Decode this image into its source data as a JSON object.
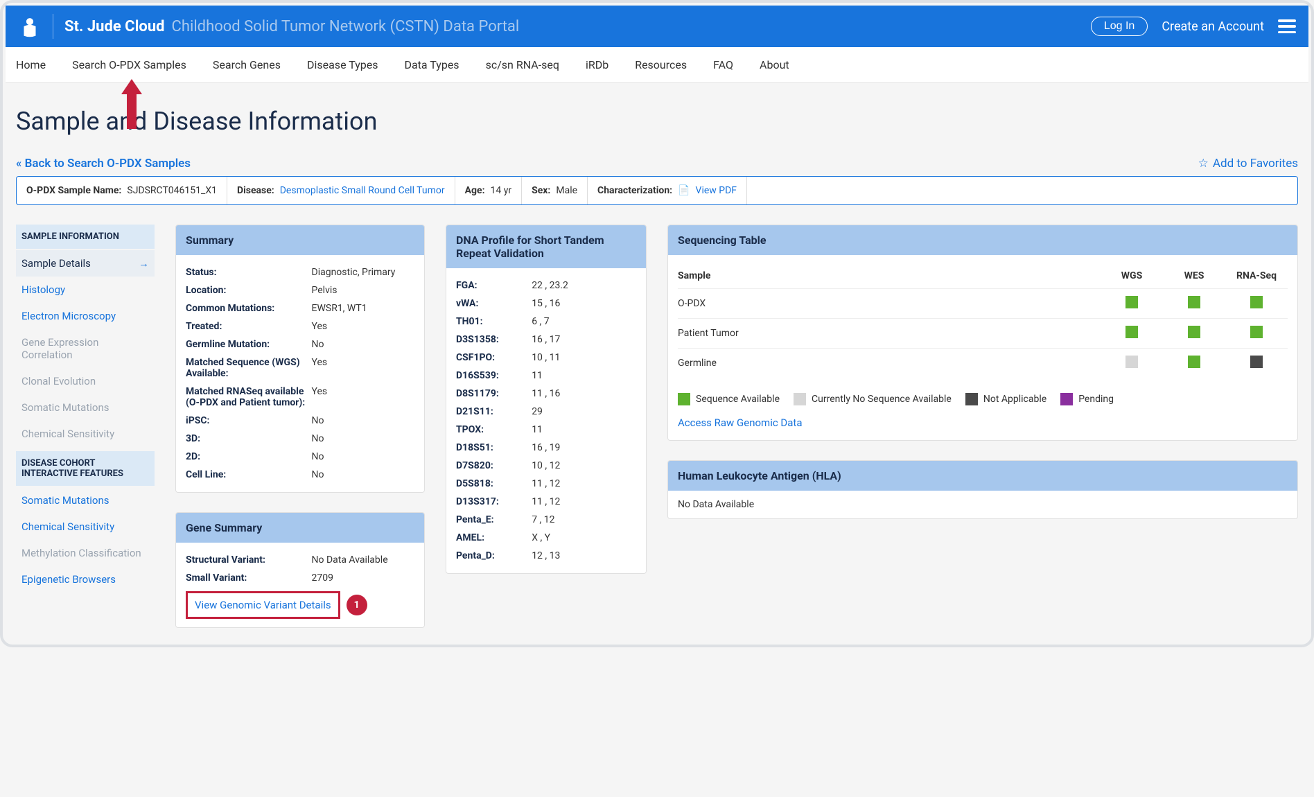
{
  "header": {
    "brand": "St. Jude Cloud",
    "subtitle": "Childhood Solid Tumor Network (CSTN) Data Portal",
    "login": "Log In",
    "create": "Create an Account"
  },
  "nav": {
    "items": [
      "Home",
      "Search O-PDX Samples",
      "Search Genes",
      "Disease Types",
      "Data Types",
      "sc/sn RNA-seq",
      "iRDb",
      "Resources",
      "FAQ",
      "About"
    ]
  },
  "page": {
    "title": "Sample and Disease Information",
    "back": "« Back to Search O-PDX Samples",
    "favorite": "Add to Favorites"
  },
  "info": {
    "sample_name_label": "O-PDX Sample Name:",
    "sample_name_value": "SJDSRCT046151_X1",
    "disease_label": "Disease:",
    "disease_value": "Desmoplastic Small Round Cell Tumor",
    "age_label": "Age:",
    "age_value": "14 yr",
    "sex_label": "Sex:",
    "sex_value": "Male",
    "char_label": "Characterization:",
    "char_value": "View PDF"
  },
  "sidebar": {
    "section1": "SAMPLE INFORMATION",
    "items1": [
      {
        "label": "Sample Details",
        "state": "active"
      },
      {
        "label": "Histology",
        "state": "link"
      },
      {
        "label": "Electron Microscopy",
        "state": "link"
      },
      {
        "label": "Gene Expression Correlation",
        "state": "muted"
      },
      {
        "label": "Clonal Evolution",
        "state": "muted"
      },
      {
        "label": "Somatic Mutations",
        "state": "muted"
      },
      {
        "label": "Chemical Sensitivity",
        "state": "muted"
      }
    ],
    "section2": "DISEASE COHORT INTERACTIVE FEATURES",
    "items2": [
      {
        "label": "Somatic Mutations",
        "state": "link"
      },
      {
        "label": "Chemical Sensitivity",
        "state": "link"
      },
      {
        "label": "Methylation Classification",
        "state": "muted"
      },
      {
        "label": "Epigenetic Browsers",
        "state": "link"
      }
    ]
  },
  "summary": {
    "title": "Summary",
    "rows": [
      {
        "k": "Status:",
        "v": "Diagnostic, Primary"
      },
      {
        "k": "Location:",
        "v": "Pelvis"
      },
      {
        "k": "Common Mutations:",
        "v": "EWSR1, WT1"
      },
      {
        "k": "Treated:",
        "v": "Yes"
      },
      {
        "k": "Germline Mutation:",
        "v": "No"
      },
      {
        "k": "Matched Sequence (WGS) Available:",
        "v": "Yes"
      },
      {
        "k": "Matched RNASeq available (O-PDX and Patient tumor):",
        "v": "Yes"
      },
      {
        "k": "iPSC:",
        "v": "No"
      },
      {
        "k": "3D:",
        "v": "No"
      },
      {
        "k": "2D:",
        "v": "No"
      },
      {
        "k": "Cell Line:",
        "v": "No"
      }
    ]
  },
  "gene_summary": {
    "title": "Gene Summary",
    "rows": [
      {
        "k": "Structural Variant:",
        "v": "No Data Available"
      },
      {
        "k": "Small Variant:",
        "v": "2709"
      }
    ],
    "view_link": "View Genomic Variant Details",
    "step": "1"
  },
  "dna": {
    "title": "DNA Profile for Short Tandem Repeat Validation",
    "rows": [
      {
        "k": "FGA:",
        "v": "22 , 23.2"
      },
      {
        "k": "vWA:",
        "v": "15 , 16"
      },
      {
        "k": "TH01:",
        "v": "6 , 7"
      },
      {
        "k": "D3S1358:",
        "v": "16 , 17"
      },
      {
        "k": "CSF1PO:",
        "v": "10 , 11"
      },
      {
        "k": "D16S539:",
        "v": "11"
      },
      {
        "k": "D8S1179:",
        "v": "11 , 16"
      },
      {
        "k": "D21S11:",
        "v": "29"
      },
      {
        "k": "TPOX:",
        "v": "11"
      },
      {
        "k": "D18S51:",
        "v": "16 , 19"
      },
      {
        "k": "D7S820:",
        "v": "10 , 12"
      },
      {
        "k": "D5S818:",
        "v": "11 , 12"
      },
      {
        "k": "D13S317:",
        "v": "11 , 12"
      },
      {
        "k": "Penta_E:",
        "v": "7 , 12"
      },
      {
        "k": "AMEL:",
        "v": "X , Y"
      },
      {
        "k": "Penta_D:",
        "v": "12 , 13"
      }
    ]
  },
  "seq": {
    "title": "Sequencing Table",
    "col_sample": "Sample",
    "cols": [
      "WGS",
      "WES",
      "RNA-Seq"
    ],
    "rows": [
      {
        "label": "O-PDX",
        "cells": [
          "green",
          "green",
          "green"
        ]
      },
      {
        "label": "Patient Tumor",
        "cells": [
          "green",
          "green",
          "green"
        ]
      },
      {
        "label": "Germline",
        "cells": [
          "gray",
          "green",
          "dark"
        ]
      }
    ],
    "legend": [
      {
        "c": "green",
        "t": "Sequence Available"
      },
      {
        "c": "gray",
        "t": "Currently No Sequence Available"
      },
      {
        "c": "dark",
        "t": "Not Applicable"
      },
      {
        "c": "purple",
        "t": "Pending"
      }
    ],
    "access": "Access Raw Genomic Data"
  },
  "hla": {
    "title": "Human Leukocyte Antigen (HLA)",
    "body": "No Data Available"
  }
}
